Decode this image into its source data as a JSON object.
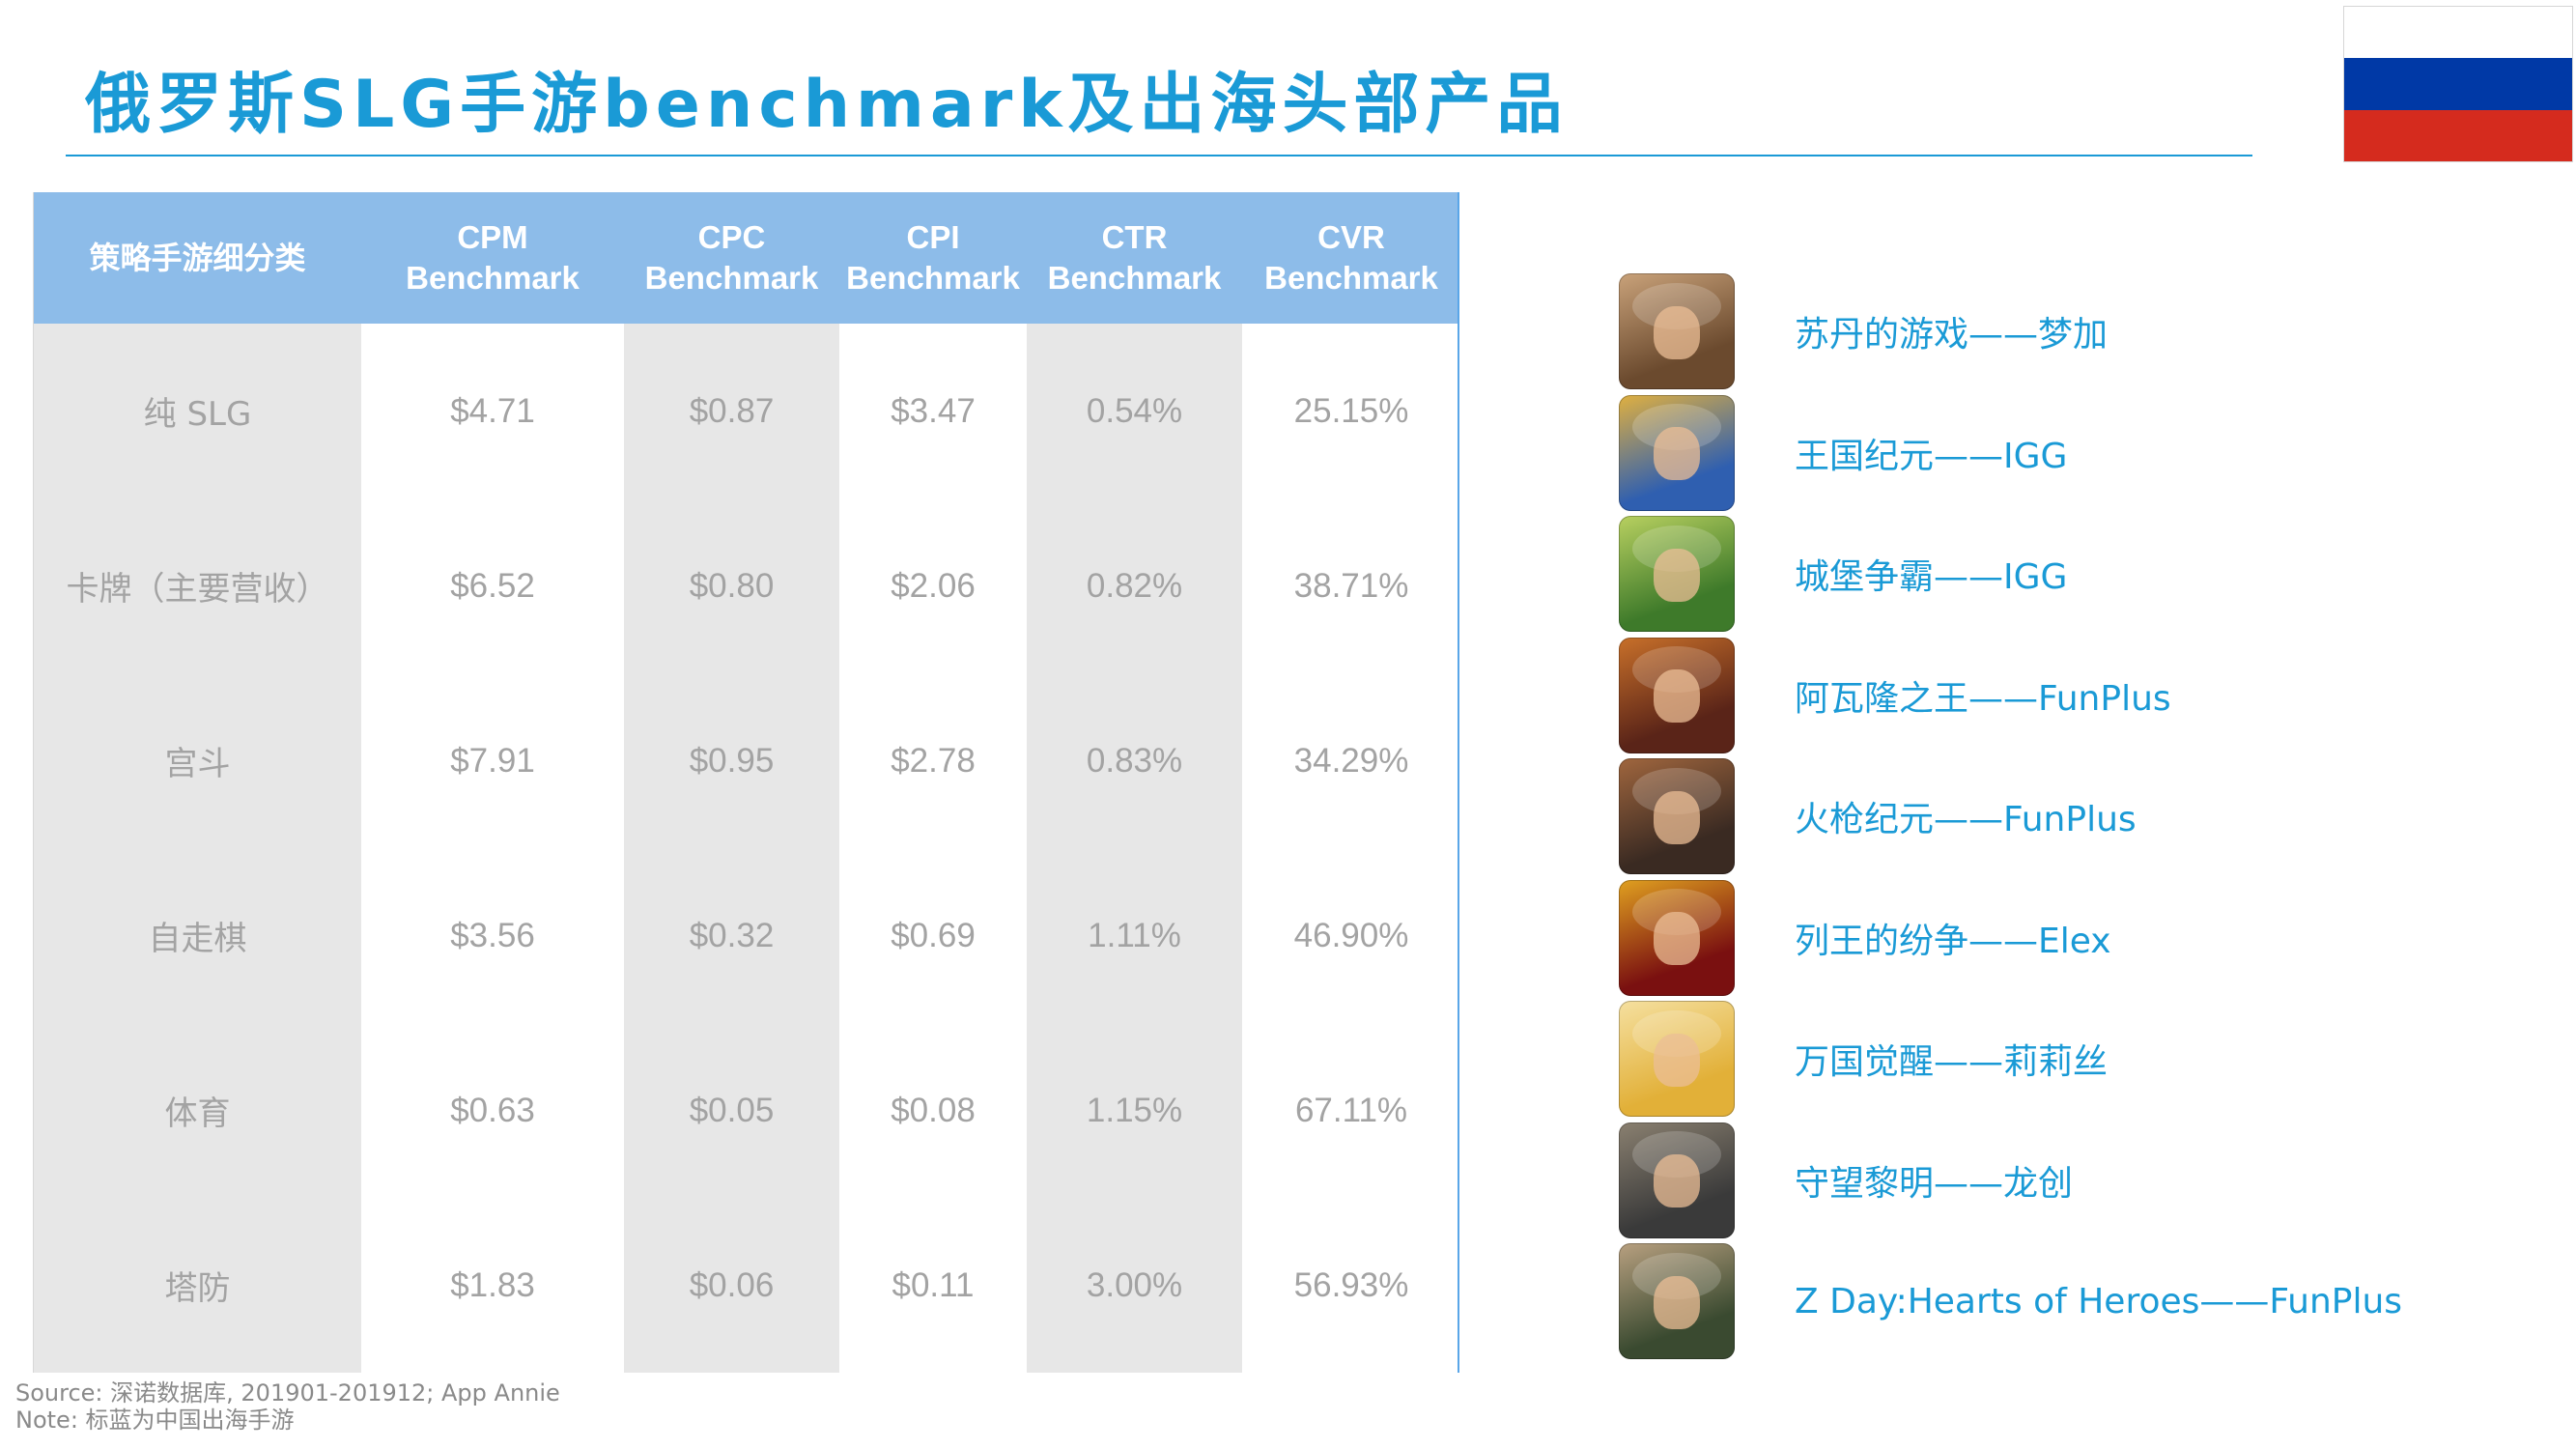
{
  "title": "俄罗斯SLG手游benchmark及出海头部产品",
  "flag": {
    "stripes": [
      "#ffffff",
      "#0039a6",
      "#d52b1e"
    ]
  },
  "table": {
    "header": {
      "category": "策略手游细分类",
      "cols": [
        {
          "line1": "CPM",
          "line2": "Benchmark"
        },
        {
          "line1": "CPC",
          "line2": "Benchmark"
        },
        {
          "line1": "CPI",
          "line2": "Benchmark"
        },
        {
          "line1": "CTR",
          "line2": "Benchmark"
        },
        {
          "line1": "CVR",
          "line2": "Benchmark"
        }
      ]
    },
    "rows": [
      {
        "category": "纯 SLG",
        "values": [
          "$4.71",
          "$0.87",
          "$3.47",
          "0.54%",
          "25.15%"
        ]
      },
      {
        "category": "卡牌（主要营收）",
        "values": [
          "$6.52",
          "$0.80",
          "$2.06",
          "0.82%",
          "38.71%"
        ]
      },
      {
        "category": "宫斗",
        "values": [
          "$7.91",
          "$0.95",
          "$2.78",
          "0.83%",
          "34.29%"
        ]
      },
      {
        "category": "自走棋",
        "values": [
          "$3.56",
          "$0.32",
          "$0.69",
          "1.11%",
          "46.90%"
        ]
      },
      {
        "category": "体育",
        "values": [
          "$0.63",
          "$0.05",
          "$0.08",
          "1.15%",
          "67.11%"
        ]
      },
      {
        "category": "塔防",
        "values": [
          "$1.83",
          "$0.06",
          "$0.11",
          "3.00%",
          "56.93%"
        ]
      }
    ]
  },
  "games": [
    {
      "label": "苏丹的游戏——梦加",
      "icon": "sultan-game-app-icon",
      "colors": [
        "#6b4a2e",
        "#c9a27a"
      ]
    },
    {
      "label": "王国纪元——IGG",
      "icon": "lords-mobile-app-icon",
      "colors": [
        "#2f5fb0",
        "#e0b040"
      ]
    },
    {
      "label": "城堡争霸——IGG",
      "icon": "castle-clash-app-icon",
      "colors": [
        "#3e7a2a",
        "#b8d060"
      ]
    },
    {
      "label": "阿瓦隆之王——FunPlus",
      "icon": "king-of-avalon-app-icon",
      "colors": [
        "#5a2418",
        "#c8702a"
      ]
    },
    {
      "label": "火枪纪元——FunPlus",
      "icon": "guns-of-glory-app-icon",
      "colors": [
        "#3a2a22",
        "#a0663e"
      ]
    },
    {
      "label": "列王的纷争——Elex",
      "icon": "clash-of-kings-app-icon",
      "colors": [
        "#7a1010",
        "#e0a020"
      ]
    },
    {
      "label": "万国觉醒——莉莉丝",
      "icon": "rise-of-kingdoms-app-icon",
      "colors": [
        "#e2b038",
        "#f5e0a0"
      ]
    },
    {
      "label": "守望黎明——龙创",
      "icon": "state-of-survival-app-icon",
      "colors": [
        "#3a3a3a",
        "#8a8070"
      ]
    },
    {
      "label": "Z Day:Hearts of Heroes——FunPlus",
      "icon": "z-day-app-icon",
      "colors": [
        "#3a4a30",
        "#b8a080"
      ]
    }
  ],
  "footnotes": {
    "source": "Source: 深诺数据库, 201901-201912; App Annie",
    "note": "Note: 标蓝为中国出海手游"
  }
}
